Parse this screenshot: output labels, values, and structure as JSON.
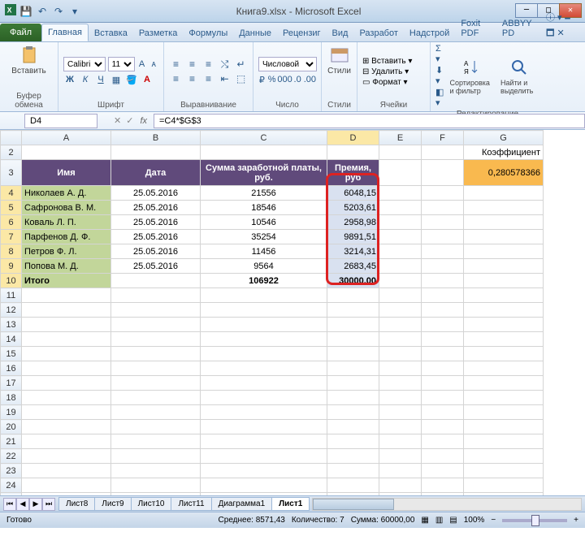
{
  "title": "Книга9.xlsx - Microsoft Excel",
  "qat": {
    "save": "💾",
    "undo": "↶",
    "redo": "↷"
  },
  "tabs": {
    "file": "Файл",
    "items": [
      "Главная",
      "Вставка",
      "Разметка",
      "Формулы",
      "Данные",
      "Рецензиг",
      "Вид",
      "Разработ",
      "Надстрой",
      "Foxit PDF",
      "ABBYY PD"
    ]
  },
  "ribbon": {
    "paste": "Вставить",
    "clipboard": "Буфер обмена",
    "font_name": "Calibri",
    "font_size": "11",
    "font_group": "Шрифт",
    "align_group": "Выравнивание",
    "number_format": "Числовой",
    "number_group": "Число",
    "styles": "Стили",
    "insert": "Вставить",
    "delete": "Удалить",
    "format": "Формат",
    "cells_group": "Ячейки",
    "sort": "Сортировка и фильтр",
    "find": "Найти и выделить",
    "editing_group": "Редактирование"
  },
  "namebox": "D4",
  "formula": "=C4*$G$3",
  "cols": [
    "A",
    "B",
    "C",
    "D",
    "E",
    "F",
    "G"
  ],
  "headers": {
    "name": "Имя",
    "date": "Дата",
    "salary": "Сумма заработной платы, руб.",
    "bonus": "Премия, руб",
    "coef_label": "Коэффициент"
  },
  "coef_value": "0,280578366",
  "rows": [
    {
      "name": "Николаев А. Д.",
      "date": "25.05.2016",
      "salary": "21556",
      "bonus": "6048,15"
    },
    {
      "name": "Сафронова В. М.",
      "date": "25.05.2016",
      "salary": "18546",
      "bonus": "5203,61"
    },
    {
      "name": "Коваль Л. П.",
      "date": "25.05.2016",
      "salary": "10546",
      "bonus": "2958,98"
    },
    {
      "name": "Парфенов Д. Ф.",
      "date": "25.05.2016",
      "salary": "35254",
      "bonus": "9891,51"
    },
    {
      "name": "Петров Ф. Л.",
      "date": "25.05.2016",
      "salary": "11456",
      "bonus": "3214,31"
    },
    {
      "name": "Попова М. Д.",
      "date": "25.05.2016",
      "salary": "9564",
      "bonus": "2683,45"
    }
  ],
  "totals": {
    "label": "Итого",
    "salary": "106922",
    "bonus": "30000,00"
  },
  "sheet_tabs": [
    "Лист8",
    "Лист9",
    "Лист10",
    "Лист11",
    "Диаграмма1",
    "Лист1"
  ],
  "status": {
    "ready": "Готово",
    "avg": "Среднее: 8571,43",
    "count": "Количество: 7",
    "sum": "Сумма: 60000,00",
    "zoom": "100%"
  }
}
